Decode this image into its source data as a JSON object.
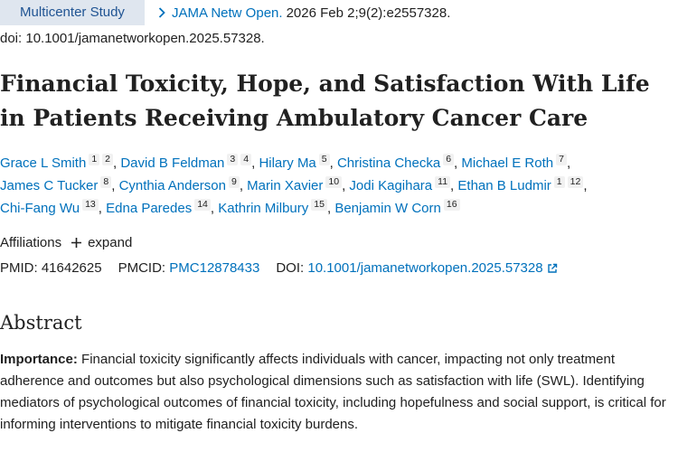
{
  "publication_type": "Multicenter Study",
  "citation": {
    "journal": "JAMA Netw Open.",
    "details": "2026 Feb 2;9(2):e2557328."
  },
  "doi_line": "doi: 10.1001/jamanetworkopen.2025.57328.",
  "title": "Financial Toxicity, Hope, and Satisfaction With Life in Patients Receiving Ambulatory Cancer Care",
  "authors": [
    {
      "name": "Grace L Smith",
      "affs": [
        "1",
        "2"
      ]
    },
    {
      "name": "David B Feldman",
      "affs": [
        "3",
        "4"
      ]
    },
    {
      "name": "Hilary Ma",
      "affs": [
        "5"
      ]
    },
    {
      "name": "Christina Checka",
      "affs": [
        "6"
      ]
    },
    {
      "name": "Michael E Roth",
      "affs": [
        "7"
      ]
    },
    {
      "name": "James C Tucker",
      "affs": [
        "8"
      ]
    },
    {
      "name": "Cynthia Anderson",
      "affs": [
        "9"
      ]
    },
    {
      "name": "Marin Xavier",
      "affs": [
        "10"
      ]
    },
    {
      "name": "Jodi Kagihara",
      "affs": [
        "11"
      ]
    },
    {
      "name": "Ethan B Ludmir",
      "affs": [
        "1",
        "12"
      ]
    },
    {
      "name": "Chi-Fang Wu",
      "affs": [
        "13"
      ]
    },
    {
      "name": "Edna Paredes",
      "affs": [
        "14"
      ]
    },
    {
      "name": "Kathrin Milbury",
      "affs": [
        "15"
      ]
    },
    {
      "name": "Benjamin W Corn",
      "affs": [
        "16"
      ]
    }
  ],
  "affiliations": {
    "label": "Affiliations",
    "expand_label": "expand"
  },
  "identifiers": {
    "pmid_label": "PMID:",
    "pmid": "41642625",
    "pmcid_label": "PMCID:",
    "pmcid": "PMC12878433",
    "doi_label": "DOI:",
    "doi": "10.1001/jamanetworkopen.2025.57328"
  },
  "abstract": {
    "heading": "Abstract",
    "importance_label": "Importance:",
    "importance_text": "Financial toxicity significantly affects individuals with cancer, impacting not only treatment adherence and outcomes but also psychological dimensions such as satisfaction with life (SWL). Identifying mediators of psychological outcomes of financial toxicity, including hopefulness and social support, is critical for informing interventions to mitigate financial toxicity burdens."
  },
  "colors": {
    "link": "#0071bc",
    "badge_bg": "#dfe6ef",
    "text": "#212121"
  },
  "icons": {
    "citation": "chevron-right-icon",
    "expand": "plus-icon",
    "doi_link": "external-link-icon"
  }
}
